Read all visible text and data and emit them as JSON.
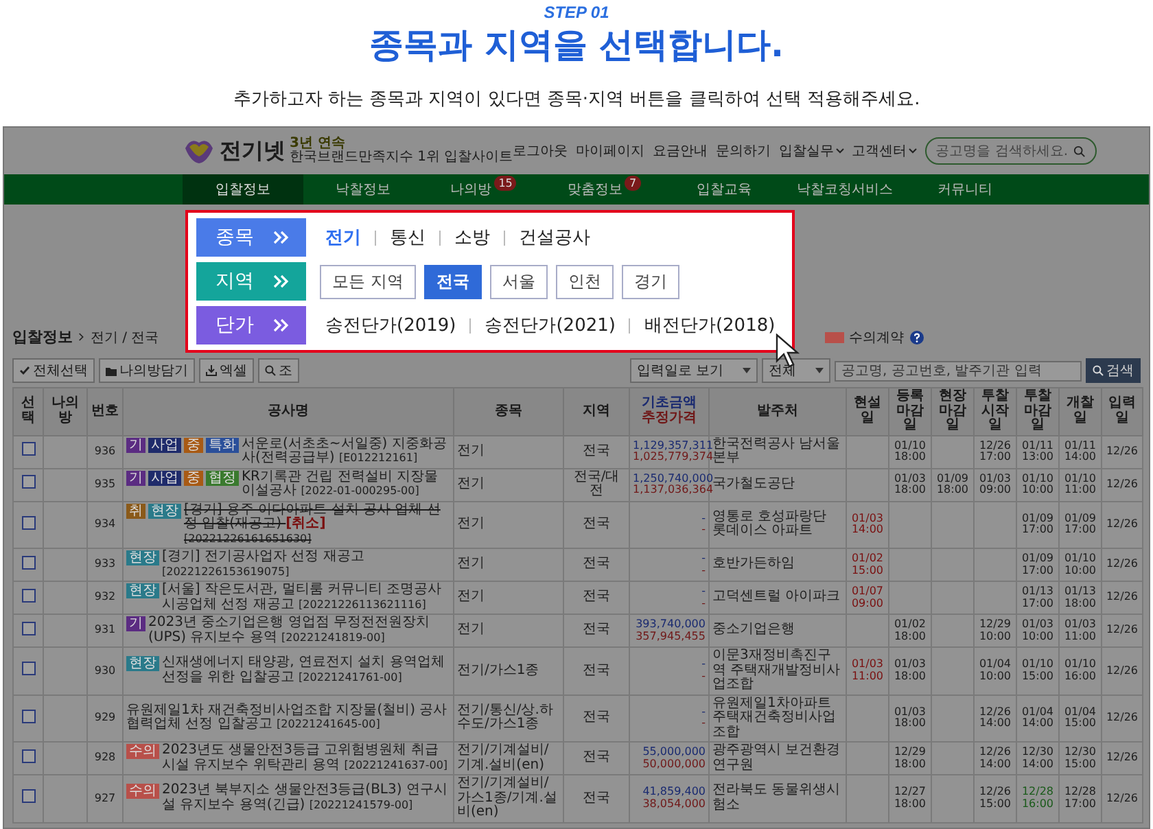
{
  "step": "STEP 01",
  "title": "종목과 지역을 선택합니다.",
  "subtitle": "추가하고자 하는 종목과 지역이 있다면 종목·지역 버튼을 클릭하여 선택 적용해주세요.",
  "site": {
    "logo": "전기넷",
    "tagline_top": "3년 연속",
    "tagline": "한국브랜드만족지수 1위 입찰사이트",
    "links": [
      {
        "label": "로그아웃",
        "dropdown": false
      },
      {
        "label": "마이페이지",
        "dropdown": false
      },
      {
        "label": "요금안내",
        "dropdown": false
      },
      {
        "label": "문의하기",
        "dropdown": false
      },
      {
        "label": "입찰실무",
        "dropdown": true
      },
      {
        "label": "고객센터",
        "dropdown": true
      }
    ],
    "search": {
      "placeholder": "공고명을 검색하세요."
    }
  },
  "nav": [
    {
      "label": "입찰정보",
      "selected": true
    },
    {
      "label": "낙찰정보",
      "selected": false
    },
    {
      "label": "나의방",
      "badge": "15",
      "selected": false
    },
    {
      "label": "맞춤정보",
      "badge": "7",
      "selected": false
    },
    {
      "label": "입찰교육",
      "selected": false
    },
    {
      "label": "낙찰코칭서비스",
      "selected": false
    },
    {
      "label": "커뮤니티",
      "selected": false
    }
  ],
  "popup": {
    "rows": [
      {
        "label": "종목",
        "color": "#4a7be8",
        "kind": "text",
        "options": [
          {
            "label": "전기",
            "selected": true
          },
          {
            "label": "통신",
            "selected": false
          },
          {
            "label": "소방",
            "selected": false
          },
          {
            "label": "건설공사",
            "selected": false
          }
        ]
      },
      {
        "label": "지역",
        "color": "#14a59b",
        "kind": "button",
        "options": [
          {
            "label": "모든 지역",
            "selected": false
          },
          {
            "label": "전국",
            "selected": true
          },
          {
            "label": "서울",
            "selected": false
          },
          {
            "label": "인천",
            "selected": false
          },
          {
            "label": "경기",
            "selected": false
          }
        ]
      },
      {
        "label": "단가",
        "color": "#7b5ce0",
        "kind": "text",
        "options": [
          {
            "label": "송전단가(2019)",
            "selected": false
          },
          {
            "label": "송전단가(2021)",
            "selected": false
          },
          {
            "label": "배전단가(2018)",
            "selected": false
          }
        ]
      }
    ]
  },
  "breadcrumb": {
    "section": "입찰정보",
    "path": "전기 / 전국"
  },
  "legend": [
    {
      "label": "수의계약",
      "color": "#b8504a"
    }
  ],
  "toolbar": {
    "buttons": [
      "전체선택",
      "나의방담기",
      "엑셀",
      "조"
    ],
    "view_select": "입력일로 보기",
    "scope_select": "전체",
    "search": {
      "placeholder": "공고명, 공고번호, 발주기관 입력"
    },
    "search_button": "검색"
  },
  "table": {
    "columns": [
      {
        "label": "선택"
      },
      {
        "label": "나의방"
      },
      {
        "label": "번호"
      },
      {
        "label": "공사명"
      },
      {
        "label": "종목"
      },
      {
        "label": "지역"
      },
      {
        "label": "기초금액",
        "sublabel": "추정가격"
      },
      {
        "label": "발주처"
      },
      {
        "label": "현설일"
      },
      {
        "label": "등록 마감일"
      },
      {
        "label": "현장 마감일"
      },
      {
        "label": "투찰 시작일"
      },
      {
        "label": "투찰 마감일"
      },
      {
        "label": "개찰일"
      },
      {
        "label": "입력일"
      }
    ],
    "rows": [
      {
        "checked": false,
        "no": "936",
        "tags": [
          {
            "label": "기",
            "color": "#5b2c82"
          },
          {
            "label": "사업",
            "color": "#1f2b6b"
          },
          {
            "label": "중",
            "color": "#a85a14"
          },
          {
            "label": "특화",
            "color": "#2a4f9a"
          }
        ],
        "title": "서운로(서초초~서일중) 지중화공사(전력공급부)",
        "cancelled": false,
        "code": "[E012212161]",
        "field": "전기",
        "region": "전국",
        "base_amount": "1,129,357,311",
        "estimated_price": "1,025,779,374",
        "client": "한국전력공사 남서울본부",
        "reg_deadline": "01/10 18:00",
        "bid_start": "12/26 17:00",
        "bid_end": "01/11 13:00",
        "bid_end_today": false,
        "opening": "01/11 14:00",
        "entered": "12/26"
      },
      {
        "checked": false,
        "no": "935",
        "tags": [
          {
            "label": "기",
            "color": "#5b2c82"
          },
          {
            "label": "사업",
            "color": "#1f2b6b"
          },
          {
            "label": "중",
            "color": "#a85a14"
          },
          {
            "label": "협정",
            "color": "#3a7a2e"
          }
        ],
        "title": "KR기록관 건립 전력설비 지장물 이설공사",
        "cancelled": false,
        "code": "[2022-01-000295-00]",
        "field": "전기",
        "region": "전국/대전",
        "base_amount": "1,250,740,000",
        "estimated_price": "1,137,036,364",
        "client": "국가철도공단",
        "reg_deadline": "01/03 18:00",
        "site_deadline": "01/09 18:00",
        "bid_start": "01/03 09:00",
        "bid_end": "01/10 10:00",
        "bid_end_today": false,
        "opening": "01/10 11:00",
        "entered": "12/26"
      },
      {
        "checked": false,
        "no": "934",
        "tags": [
          {
            "label": "취",
            "color": "#8a5a1a"
          },
          {
            "label": "현장",
            "color": "#2a7a8a"
          }
        ],
        "title": "[경기] 용주 이다아파트 설치 공사 업체 선정 입찰(재공고)",
        "cancelled": true,
        "cancel_label": "[취소]",
        "code": "[20221226161651630]",
        "field": "전기",
        "region": "전국",
        "base_amount": "-",
        "estimated_price": "-",
        "client": "영통로 호성파랑단 롯데이스 아파트",
        "briefing": "01/03 14:00",
        "bid_end": "01/09 17:00",
        "bid_end_today": false,
        "opening": "01/09 17:00",
        "entered": "12/26"
      },
      {
        "checked": false,
        "no": "933",
        "tags": [
          {
            "label": "현장",
            "color": "#2a7a8a"
          }
        ],
        "title": "[경기] 전기공사업자 선정 재공고",
        "cancelled": false,
        "code": "[20221226153619075]",
        "field": "전기",
        "region": "전국",
        "base_amount": "-",
        "estimated_price": "-",
        "client": "호반가든하임",
        "briefing": "01/02 15:00",
        "bid_end": "01/09 17:00",
        "bid_end_today": false,
        "opening": "01/10 10:00",
        "entered": "12/26"
      },
      {
        "checked": false,
        "no": "932",
        "tags": [
          {
            "label": "현장",
            "color": "#2a7a8a"
          }
        ],
        "title": "[서울] 작은도서관, 멀티룸 커뮤니티 조명공사 시공업체 선정 재공고",
        "cancelled": false,
        "code": "[20221226113621116]",
        "field": "전기",
        "region": "전국",
        "base_amount": "-",
        "estimated_price": "-",
        "client": "고덕센트럴 아이파크",
        "briefing": "01/07 09:00",
        "bid_end": "01/13 17:00",
        "bid_end_today": false,
        "opening": "01/13 18:00",
        "entered": "12/26"
      },
      {
        "checked": false,
        "no": "931",
        "tags": [
          {
            "label": "기",
            "color": "#5b2c82"
          }
        ],
        "title": "2023년 중소기업은행 영업점 무정전전원장치(UPS) 유지보수 용역",
        "cancelled": false,
        "code": "[20221241819-00]",
        "field": "전기",
        "region": "전국",
        "base_amount": "393,740,000",
        "estimated_price": "357,945,455",
        "client": "중소기업은행",
        "reg_deadline": "01/02 18:00",
        "bid_start": "12/29 10:00",
        "bid_end": "01/03 10:00",
        "bid_end_today": false,
        "opening": "01/03 11:00",
        "entered": "12/26"
      },
      {
        "checked": false,
        "no": "930",
        "tags": [
          {
            "label": "현장",
            "color": "#2a7a8a"
          }
        ],
        "title": "신재생에너지 태양광, 연료전지 설치 용역업체 선정을 위한 입찰공고",
        "cancelled": false,
        "code": "[20221241761-00]",
        "field": "전기/가스1종",
        "region": "전국",
        "base_amount": "-",
        "estimated_price": "-",
        "client": "이문3재정비촉진구역 주택재개발정비사업조합",
        "briefing": "01/03 11:00",
        "reg_deadline": "01/03 18:00",
        "bid_start": "01/04 10:00",
        "bid_end": "01/10 15:00",
        "bid_end_today": false,
        "opening": "01/10 16:00",
        "entered": "12/26"
      },
      {
        "checked": false,
        "no": "929",
        "tags": [],
        "title": "유원제일1차 재건축정비사업조합 지장물(철비) 공사 협력업체 선정 입찰공고",
        "cancelled": false,
        "code": "[20221241645-00]",
        "field": "전기/통신/상.하수도/가스1종",
        "region": "전국",
        "base_amount": "-",
        "estimated_price": "-",
        "client": "유원제일1차아파트주택재건축정비사업조합",
        "reg_deadline": "01/03 18:00",
        "bid_start": "12/26 14:00",
        "bid_end": "01/04 14:00",
        "bid_end_today": false,
        "opening": "01/04 15:00",
        "entered": "12/26"
      },
      {
        "checked": false,
        "no": "928",
        "tags": [
          {
            "label": "수의",
            "color": "#b8504a"
          }
        ],
        "title": "2023년도 생물안전3등급 고위험병원체 취급시설 유지보수 위탁관리 용역",
        "cancelled": false,
        "code": "[20221241637-00]",
        "field": "전기/기계설비/기계.설비(en)",
        "region": "전국",
        "base_amount": "55,000,000",
        "estimated_price": "50,000,000",
        "client": "광주광역시 보건환경연구원",
        "reg_deadline": "12/29 18:00",
        "bid_start": "12/26 14:00",
        "bid_end": "12/30 14:00",
        "bid_end_today": false,
        "opening": "12/30 15:00",
        "entered": "12/26"
      },
      {
        "checked": false,
        "no": "927",
        "tags": [
          {
            "label": "수의",
            "color": "#b8504a"
          }
        ],
        "title": "2023년 북부지소 생물안전3등급(BL3) 연구시설 유지보수 용역(긴급)",
        "cancelled": false,
        "code": "[20221241579-00]",
        "field": "전기/기계설비/가스1종/기계.설비(en)",
        "region": "전국",
        "base_amount": "41,859,400",
        "estimated_price": "38,054,000",
        "client": "전라북도 동물위생시험소",
        "reg_deadline": "12/27 18:00",
        "bid_start": "12/26 15:00",
        "bid_end": "12/28 16:00",
        "bid_end_today": true,
        "opening": "12/28 17:00",
        "entered": "12/26"
      }
    ]
  }
}
